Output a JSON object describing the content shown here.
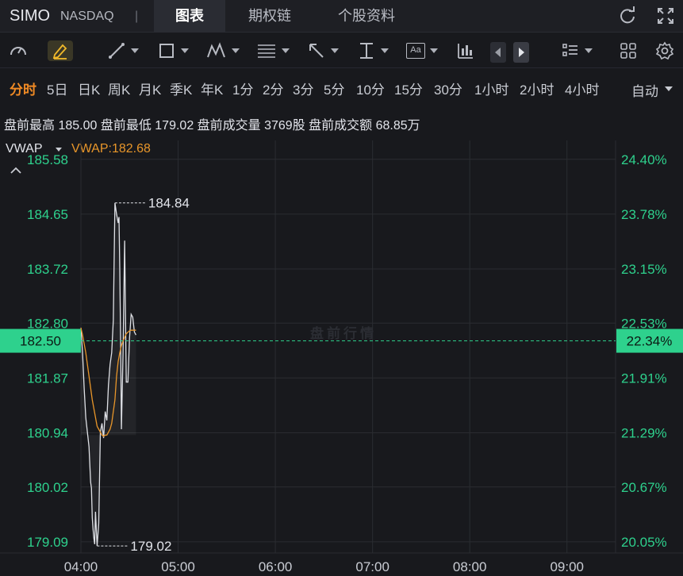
{
  "header": {
    "ticker": "SIMO",
    "exchange": "NASDAQ",
    "separator": "|",
    "tabs": [
      {
        "label": "图表",
        "active": true
      },
      {
        "label": "期权链",
        "active": false
      },
      {
        "label": "个股资料",
        "active": false
      }
    ],
    "icons": [
      "refresh-icon",
      "fullscreen-icon"
    ]
  },
  "toolbar": {
    "tools": [
      "gauge-icon",
      "pen-icon",
      "line-tool-icon",
      "rectangle-tool-icon",
      "pattern-tool-icon",
      "fibonacci-tool-icon",
      "arrow-tool-icon",
      "measure-tool-icon",
      "text-tool-icon",
      "indicator-chart-icon",
      "prev-icon",
      "next-icon",
      "layout-list-icon",
      "grid-icon",
      "settings-icon"
    ],
    "text_tool_label": "Aa"
  },
  "periods": {
    "items": [
      "分时",
      "5日",
      "日K",
      "周K",
      "月K",
      "季K",
      "年K",
      "1分",
      "2分",
      "3分",
      "5分",
      "10分",
      "15分",
      "30分",
      "1小时",
      "2小时",
      "4小时"
    ],
    "active": "分时",
    "scale_mode": "自动"
  },
  "premarket": {
    "text": "盘前最高 185.00  盘前最低 179.02  盘前成交量 3769股  盘前成交额 68.85万"
  },
  "indicator": {
    "name": "VWAP",
    "value_label": "VWAP:182.68"
  },
  "colors": {
    "up": "#2ed18d",
    "price_line": "#dfe1e6",
    "vwap_line": "#e8962a",
    "background": "#18191d"
  },
  "chart_data": {
    "type": "line",
    "watermark": "盘前行情",
    "x_ticks": [
      "04:00",
      "05:00",
      "06:00",
      "07:00",
      "08:00",
      "09:00"
    ],
    "y_ticks_left": [
      "185.58",
      "184.65",
      "183.72",
      "182.80",
      "181.87",
      "180.94",
      "180.02",
      "179.09"
    ],
    "y_ticks_right": [
      "24.40%",
      "23.78%",
      "23.15%",
      "22.53%",
      "21.91%",
      "21.29%",
      "20.67%",
      "20.05%"
    ],
    "ylim": [
      178.9,
      185.9
    ],
    "xlim_minutes": [
      0,
      330
    ],
    "current_price": "182.50",
    "current_change": "22.34%",
    "high_label": "184.84",
    "low_label": "179.02",
    "series": [
      {
        "role": "price",
        "x_minutes": [
          0,
          1,
          2,
          3,
          4,
          5,
          6,
          6.5,
          7,
          7.5,
          8,
          8.5,
          9,
          9.5,
          10,
          11,
          12,
          13,
          14,
          15,
          16,
          17,
          18,
          19,
          20,
          21,
          22,
          23,
          23.5,
          24,
          24.5,
          25,
          26,
          27,
          28,
          29,
          30,
          31,
          32,
          33,
          34
        ],
        "values": [
          182.72,
          182.3,
          181.7,
          181.2,
          180.95,
          180.7,
          180.1,
          180.0,
          179.5,
          179.3,
          179.15,
          179.05,
          179.6,
          179.3,
          179.02,
          179.4,
          180.95,
          181.1,
          180.85,
          181.3,
          181.15,
          181.75,
          182.1,
          182.3,
          182.85,
          184.84,
          184.65,
          184.5,
          184.6,
          183.7,
          182.5,
          181.0,
          182.3,
          184.2,
          181.8,
          181.8,
          182.55,
          182.95,
          182.9,
          182.65,
          182.6
        ]
      },
      {
        "role": "vwap",
        "x_minutes": [
          0,
          1,
          2,
          3,
          4,
          5,
          6,
          7,
          8,
          9,
          10,
          11,
          12,
          13,
          14,
          15,
          16,
          17,
          18,
          19,
          20,
          21,
          22,
          23,
          24,
          25,
          26,
          28,
          30,
          31,
          32,
          34
        ],
        "values": [
          182.72,
          182.6,
          182.45,
          182.3,
          182.1,
          181.9,
          181.7,
          181.5,
          181.35,
          181.2,
          181.05,
          181.0,
          180.95,
          180.9,
          180.88,
          180.9,
          180.9,
          180.95,
          181.0,
          181.1,
          181.3,
          181.5,
          181.9,
          182.15,
          182.3,
          182.42,
          182.5,
          182.62,
          182.67,
          182.68,
          182.68,
          182.68
        ]
      }
    ]
  }
}
